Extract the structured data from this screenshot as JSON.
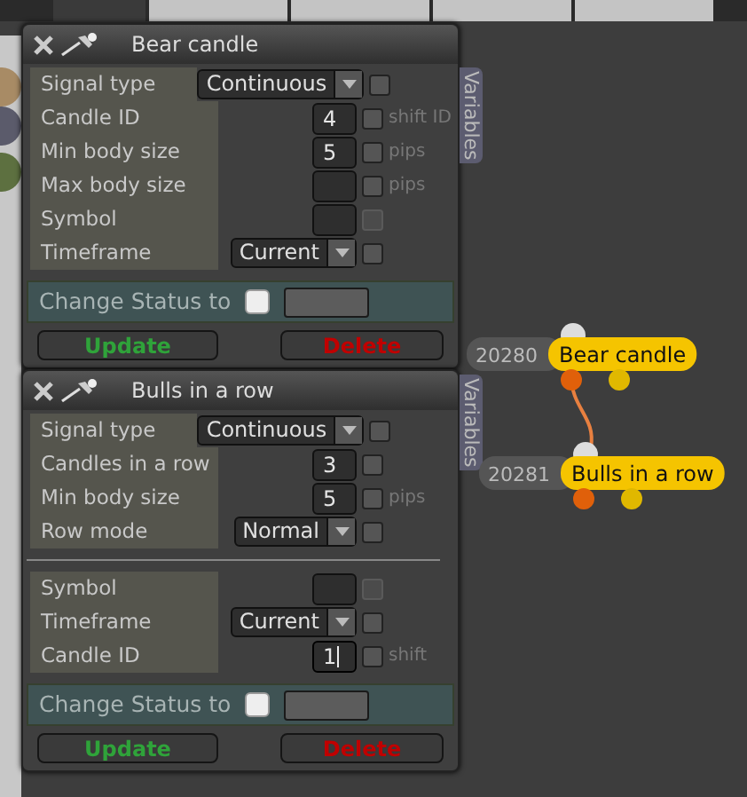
{
  "top_tabs": [
    {
      "selected": true
    },
    {
      "selected": false
    },
    {
      "selected": false
    },
    {
      "selected": false
    },
    {
      "selected": false
    }
  ],
  "side_dots": [
    {
      "color": "#a88b65"
    },
    {
      "color": "#5b5b6b"
    },
    {
      "color": "#5d7040"
    }
  ],
  "panels": [
    {
      "title": "Bear candle",
      "variables_tab": "Variables",
      "sections": [
        [
          {
            "kind": "select",
            "label": "Signal type",
            "value": "Continuous",
            "checked": false,
            "disabled": false
          },
          {
            "kind": "input",
            "label": "Candle ID",
            "value": "4",
            "unit": "shift ID",
            "checked": false,
            "disabled": false,
            "focused": false
          },
          {
            "kind": "input",
            "label": "Min body size",
            "value": "5",
            "unit": "pips",
            "checked": false,
            "disabled": false,
            "focused": false
          },
          {
            "kind": "input",
            "label": "Max body size",
            "unit": "pips",
            "checked": false,
            "disabled": false,
            "focused": false
          },
          {
            "kind": "input",
            "label": "Symbol",
            "checked": false,
            "disabled": true,
            "focused": false
          },
          {
            "kind": "select",
            "label": "Timeframe",
            "value": "Current",
            "checked": false,
            "disabled": false
          }
        ]
      ],
      "status_label": "Change Status to",
      "status_checked": false,
      "update": "Update",
      "delete": "Delete"
    },
    {
      "title": "Bulls in a row",
      "variables_tab": "Variables",
      "sections": [
        [
          {
            "kind": "select",
            "label": "Signal type",
            "value": "Continuous",
            "checked": false,
            "disabled": false
          },
          {
            "kind": "input",
            "label": "Candles in a row",
            "value": "3",
            "checked": false,
            "disabled": false,
            "focused": false
          },
          {
            "kind": "input",
            "label": "Min body size",
            "value": "5",
            "unit": "pips",
            "checked": false,
            "disabled": false,
            "focused": false
          },
          {
            "kind": "select",
            "label": "Row mode",
            "value": "Normal",
            "checked": false,
            "disabled": false
          }
        ],
        [
          {
            "kind": "input",
            "label": "Symbol",
            "checked": false,
            "disabled": true,
            "focused": false
          },
          {
            "kind": "select",
            "label": "Timeframe",
            "value": "Current",
            "checked": false,
            "disabled": false
          },
          {
            "kind": "input",
            "label": "Candle ID",
            "value": "1",
            "unit": "shift",
            "checked": false,
            "disabled": false,
            "focused": true
          }
        ]
      ],
      "status_label": "Change Status to",
      "status_checked": false,
      "update": "Update",
      "delete": "Delete"
    }
  ],
  "nodes": [
    {
      "id": "20280",
      "label": "Bear candle"
    },
    {
      "id": "20281",
      "label": "Bulls in a row"
    }
  ]
}
